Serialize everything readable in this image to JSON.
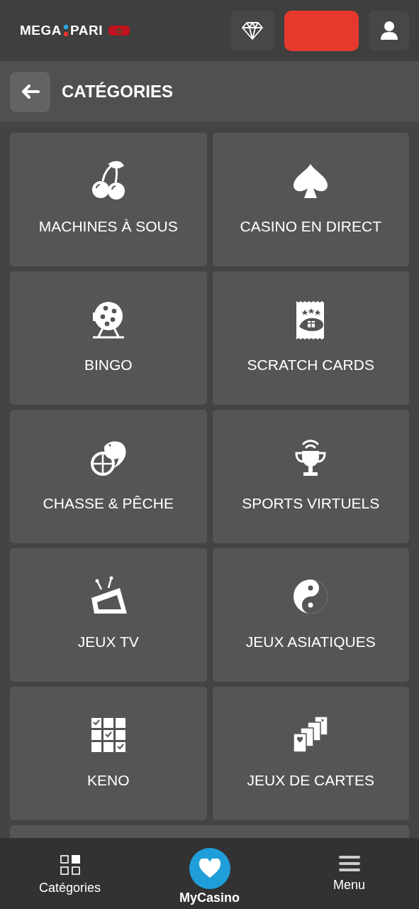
{
  "header": {
    "logo": {
      "left": "MEGA",
      "right": "PARI"
    }
  },
  "title_bar": {
    "title": "CATÉGORIES"
  },
  "categories": [
    {
      "label": "MACHINES À SOUS"
    },
    {
      "label": "CASINO EN DIRECT"
    },
    {
      "label": "BINGO"
    },
    {
      "label": "SCRATCH CARDS"
    },
    {
      "label": "CHASSE & PÊCHE"
    },
    {
      "label": "SPORTS VIRTUELS"
    },
    {
      "label": "JEUX TV"
    },
    {
      "label": "JEUX ASIATIQUES"
    },
    {
      "label": "KENO"
    },
    {
      "label": "JEUX DE CARTES"
    }
  ],
  "bottom_nav": [
    {
      "label": "Catégories",
      "kind": "grid"
    },
    {
      "label": "MyCasino",
      "kind": "featured"
    },
    {
      "label": "Menu",
      "kind": "menu"
    }
  ]
}
